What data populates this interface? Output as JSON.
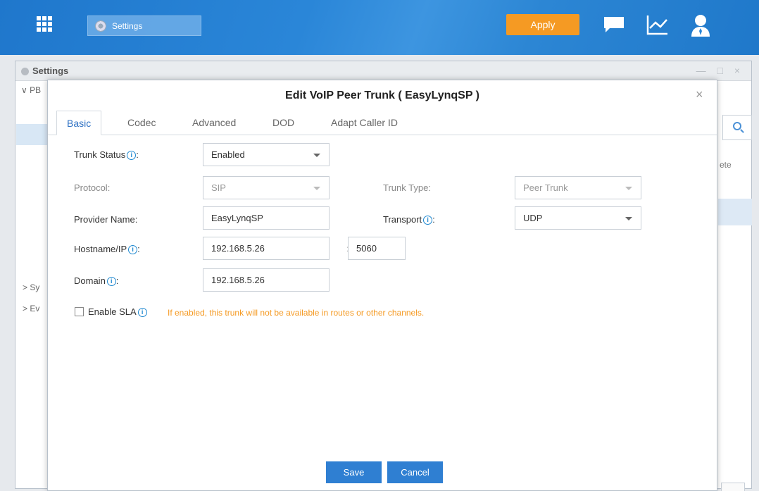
{
  "topbar": {
    "task_tab_label": "Settings",
    "apply_label": "Apply",
    "accent_color": "#f59a23",
    "icons": [
      "apps-grid-icon",
      "settings-icon",
      "chat-icon",
      "chart-icon",
      "user-icon"
    ]
  },
  "settings_window": {
    "title": "Settings",
    "window_controls": "— □ ×",
    "tree": {
      "pbx": "PB",
      "system": "Sy",
      "event": "Ev"
    },
    "column_header_partial": "ete"
  },
  "modal": {
    "title": "Edit VoIP Peer Trunk ( EasyLynqSP )",
    "close_symbol": "×",
    "tabs": [
      {
        "label": "Basic"
      },
      {
        "label": "Codec"
      },
      {
        "label": "Advanced"
      },
      {
        "label": "DOD"
      },
      {
        "label": "Adapt Caller ID"
      }
    ],
    "form": {
      "trunk_status_label": "Trunk Status",
      "trunk_status_value": "Enabled",
      "protocol_label": "Protocol:",
      "protocol_value": "SIP",
      "trunk_type_label": "Trunk Type:",
      "trunk_type_value": "Peer Trunk",
      "provider_name_label": "Provider Name:",
      "provider_name_value": "EasyLynqSP",
      "transport_label": "Transport",
      "transport_value": "UDP",
      "hostname_label": "Hostname/IP",
      "hostname_value": "192.168.5.26",
      "port_separator": ":",
      "port_value": "5060",
      "domain_label": "Domain",
      "domain_value": "192.168.5.26",
      "enable_sla_label": "Enable SLA",
      "sla_warning": "If enabled, this trunk will not be available in routes or other channels."
    },
    "buttons": {
      "save": "Save",
      "cancel": "Cancel"
    }
  }
}
